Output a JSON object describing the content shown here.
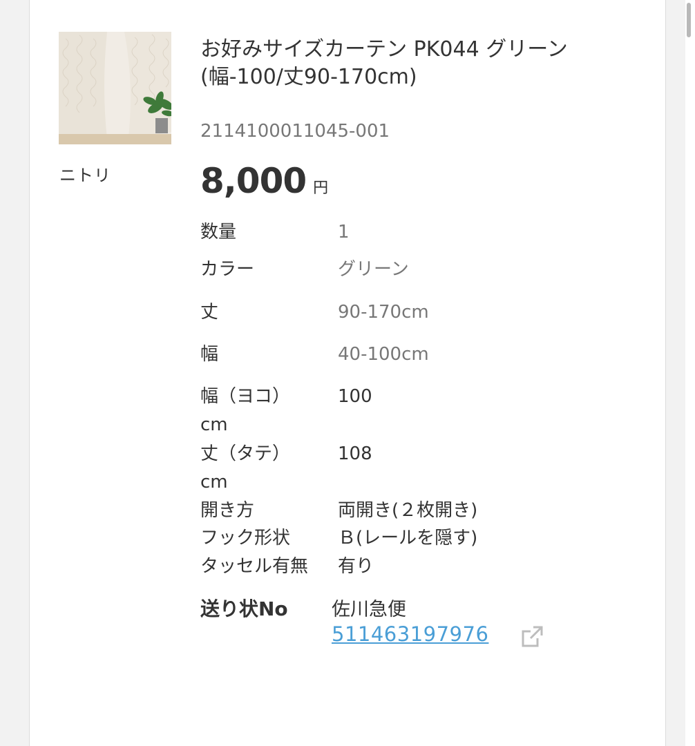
{
  "product": {
    "brand": "ニトリ",
    "title": "お好みサイズカーテン PK044 グリーン(幅-100/丈90-170cm)",
    "code": "2114100011045-001",
    "price": "8,000",
    "price_unit": "円"
  },
  "specs": [
    {
      "label": "数量",
      "value": "1"
    },
    {
      "label": "カラー",
      "value": "グリーン"
    },
    {
      "label": "丈",
      "value": "90-170cm"
    },
    {
      "label": "幅",
      "value": "40-100cm"
    },
    {
      "label": "幅（ヨコ）cm",
      "value": "100"
    },
    {
      "label": "丈（タテ）cm",
      "value": "108"
    },
    {
      "label": "開き方",
      "value": "両開き(２枚開き)"
    },
    {
      "label": "フック形状",
      "value": "Ｂ(レールを隠す)"
    },
    {
      "label": "タッセル有無",
      "value": "有り"
    }
  ],
  "shipping": {
    "label": "送り状No",
    "carrier": "佐川急便",
    "tracking_number": "511463197976"
  },
  "icons": {
    "external_link": "external-link-icon"
  },
  "colors": {
    "link": "#4a9ed6",
    "muted_text": "#777777",
    "text": "#333333"
  }
}
